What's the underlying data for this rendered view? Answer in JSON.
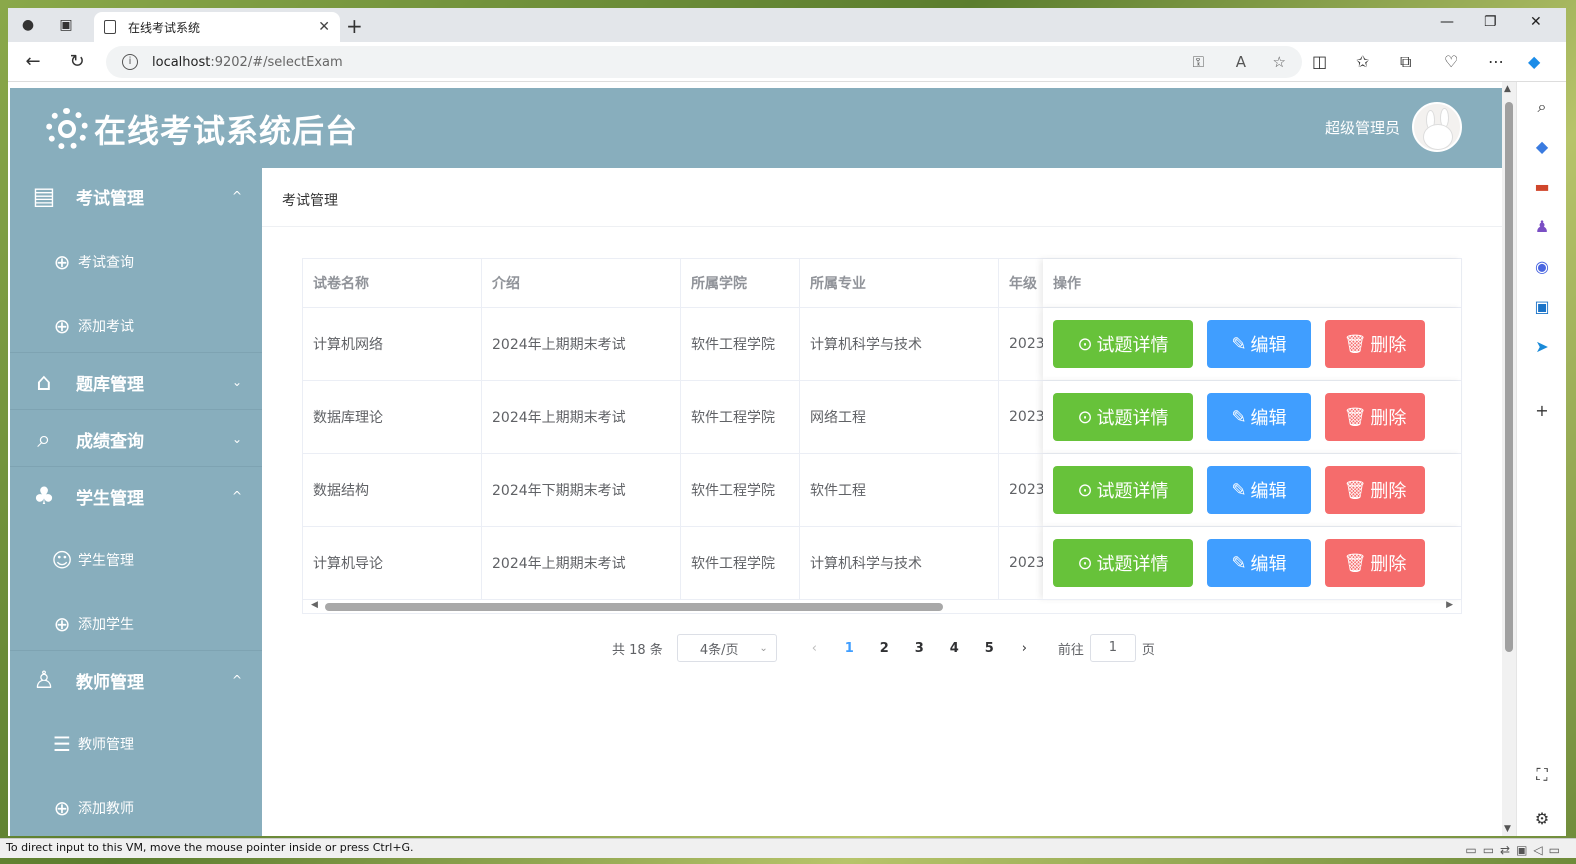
{
  "browser": {
    "tab_title": "在线考试系统",
    "tab_close": "✕",
    "new_tab": "+",
    "url_host": "localhost",
    "url_rest": ":9202/#/selectExam",
    "win_min": "—",
    "win_max": "❐",
    "win_close": "✕"
  },
  "app": {
    "title": "在线考试系统后台",
    "user_name": "超级管理员"
  },
  "sidebar": {
    "items": [
      {
        "label": "考试管理",
        "icon": "document-icon",
        "chevron": "^"
      },
      {
        "label": "考试查询",
        "icon": "search-icon"
      },
      {
        "label": "添加考试",
        "icon": "add-circle-icon"
      },
      {
        "label": "题库管理",
        "icon": "school-icon",
        "chevron": "⌄"
      },
      {
        "label": "成绩查询",
        "icon": "search-icon",
        "chevron": "⌄"
      },
      {
        "label": "学生管理",
        "icon": "users-icon",
        "chevron": "^"
      },
      {
        "label": "学生管理",
        "icon": "user-icon"
      },
      {
        "label": "添加学生",
        "icon": "add-circle-icon"
      },
      {
        "label": "教师管理",
        "icon": "teacher-icon",
        "chevron": "^"
      },
      {
        "label": "教师管理",
        "icon": "list-icon"
      },
      {
        "label": "添加教师",
        "icon": "add-circle-icon"
      }
    ]
  },
  "breadcrumb": "考试管理",
  "table": {
    "headers": [
      "试卷名称",
      "介绍",
      "所属学院",
      "所属专业",
      "年级",
      "操作"
    ],
    "rows": [
      {
        "name": "计算机网络",
        "intro": "2024年上期期末考试",
        "college": "软件工程学院",
        "major": "计算机科学与技术",
        "grade": "2023"
      },
      {
        "name": "数据库理论",
        "intro": "2024年上期期末考试",
        "college": "软件工程学院",
        "major": "网络工程",
        "grade": "2023"
      },
      {
        "name": "数据结构",
        "intro": "2024年下期期末考试",
        "college": "软件工程学院",
        "major": "软件工程",
        "grade": "2023"
      },
      {
        "name": "计算机导论",
        "intro": "2024年上期期末考试",
        "college": "软件工程学院",
        "major": "计算机科学与技术",
        "grade": "2023"
      }
    ],
    "actions": {
      "detail": "试题详情",
      "edit": "编辑",
      "delete": "删除"
    }
  },
  "pagination": {
    "total": "共 18 条",
    "page_size": "4条/页",
    "pages": [
      "1",
      "2",
      "3",
      "4",
      "5"
    ],
    "current": "1",
    "goto_prefix": "前往",
    "goto_value": "1",
    "goto_suffix": "页"
  },
  "status_bar": "To direct input to this VM, move the mouse pointer inside or press Ctrl+G."
}
